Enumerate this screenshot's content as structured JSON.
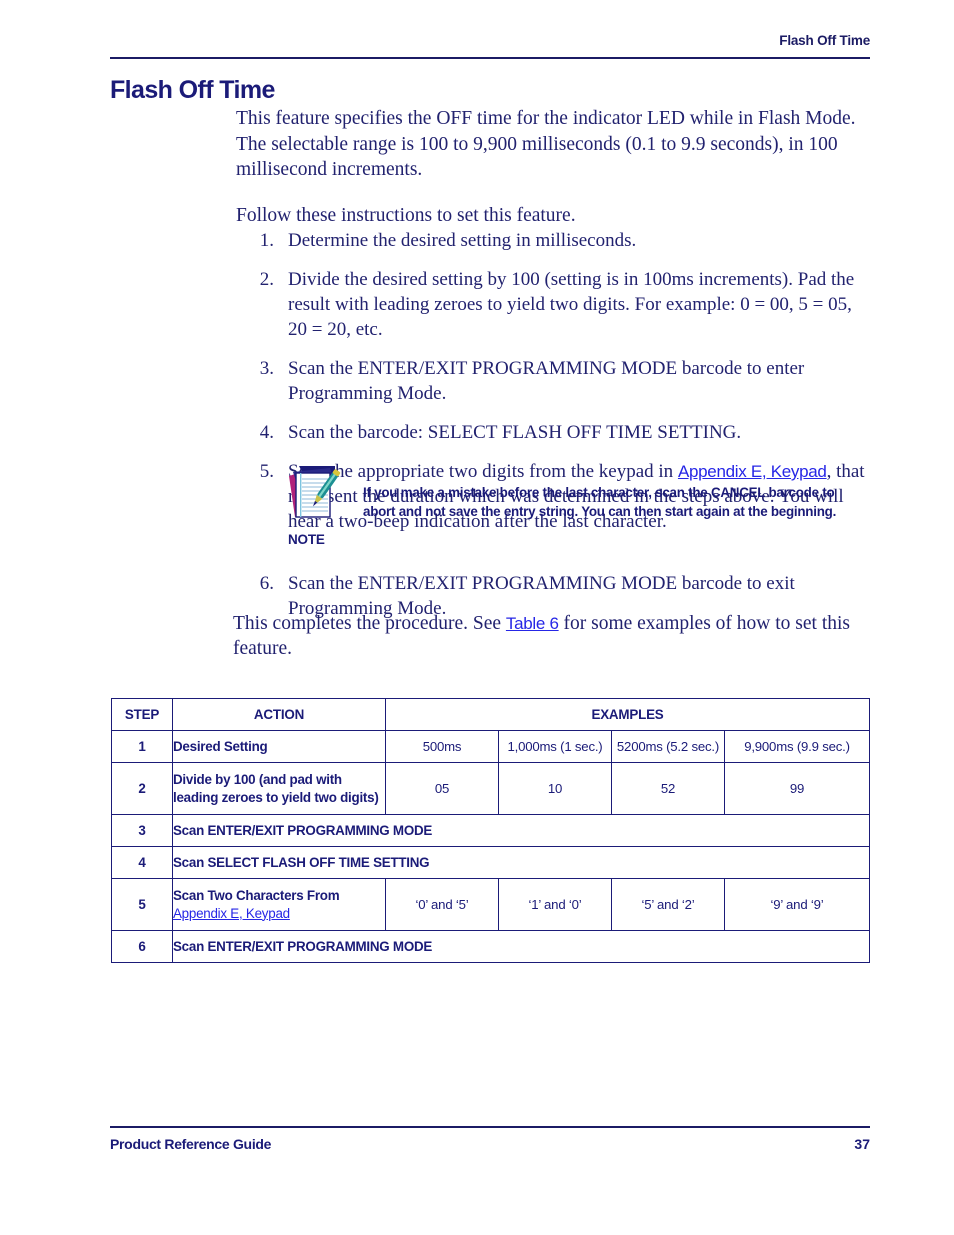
{
  "header": {
    "running_title": "Flash Off Time"
  },
  "heading": "Flash Off Time",
  "intro": {
    "paragraph1": "This feature specifies the OFF time for the indicator LED while in Flash Mode. The selectable range is 100 to 9,900 milliseconds (0.1 to 9.9 seconds), in 100 millisecond increments.",
    "paragraph2": "Follow these instructions to set this feature."
  },
  "steps": [
    {
      "num": "1.",
      "text": "Determine the desired setting in milliseconds."
    },
    {
      "num": "2.",
      "text": "Divide the desired setting by 100 (setting is in 100ms increments). Pad the result with leading zeroes to yield two digits. For example: 0 = 00, 5 = 05, 20 = 20, etc."
    },
    {
      "num": "3.",
      "text": "Scan the ENTER/EXIT PROGRAMMING MODE barcode to enter Programming Mode."
    },
    {
      "num": "4.",
      "text": "Scan the barcode: SELECT FLASH OFF TIME SETTING."
    }
  ],
  "step5": {
    "num": "5.",
    "text_before": "Scan the appropriate two digits from the keypad in ",
    "link": "Appendix E, Keypad",
    "text_after": ", that represent the duration which was determined in the steps above. You will hear a two-beep indication after the last character."
  },
  "note": {
    "icon": "notepad-pen-icon",
    "label": "NOTE",
    "text": "If you make a mistake before the last character, scan the CANCEL barcode to abort and not save the entry string. You can then start again at the beginning."
  },
  "step6": {
    "num": "6.",
    "text": "Scan the ENTER/EXIT PROGRAMMING MODE barcode to exit Programming Mode."
  },
  "closing": {
    "text_before": "This completes the procedure. See ",
    "link": "Table 6",
    "text_after": " for some examples of how to set this feature."
  },
  "table": {
    "headers": {
      "step": "STEP",
      "action": "ACTION",
      "examples": "EXAMPLES"
    },
    "rows": [
      {
        "step": "1",
        "action": "Desired Setting",
        "action_link": "",
        "full_width": false,
        "examples": [
          "500ms",
          "1,000ms (1 sec.)",
          "5200ms (5.2 sec.)",
          "9,900ms (9.9 sec.)"
        ]
      },
      {
        "step": "2",
        "action": "Divide by 100 (and pad with leading zeroes to yield two digits)",
        "action_link": "",
        "full_width": false,
        "examples": [
          "05",
          "10",
          "52",
          "99"
        ]
      },
      {
        "step": "3",
        "action": "Scan ENTER/EXIT PROGRAMMING MODE",
        "action_link": "",
        "full_width": true,
        "examples": []
      },
      {
        "step": "4",
        "action": "Scan SELECT FLASH OFF TIME SETTING",
        "action_link": "",
        "full_width": true,
        "examples": []
      },
      {
        "step": "5",
        "action": "Scan Two Characters From",
        "action_link": "Appendix E, Keypad",
        "full_width": false,
        "examples": [
          "‘0’ and ‘5’",
          "‘1’ and ‘0’",
          "‘5’ and ‘2’",
          "‘9’ and ‘9’"
        ]
      },
      {
        "step": "6",
        "action": "Scan ENTER/EXIT PROGRAMMING MODE",
        "action_link": "",
        "full_width": true,
        "examples": []
      }
    ]
  },
  "footer": {
    "left": "Product Reference Guide",
    "page_number": "37"
  },
  "colors": {
    "body_text": "#22226f",
    "heading": "#1b1b78",
    "link": "#2626e6",
    "rule": "#1b1b64"
  }
}
